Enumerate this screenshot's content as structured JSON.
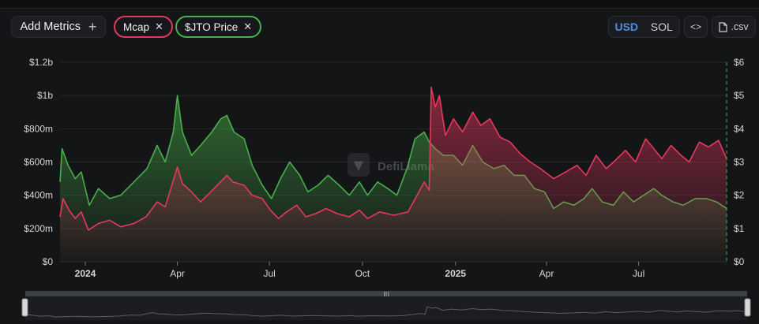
{
  "toolbar": {
    "add_metrics_label": "Add Metrics",
    "add_icon": "plus-icon",
    "chips": [
      {
        "label": "Mcap",
        "color": "#e8375f"
      },
      {
        "label": "$JTO Price",
        "color": "#48b04a"
      }
    ],
    "remove_icon": "close-icon",
    "currency": {
      "options": [
        "USD",
        "SOL"
      ],
      "selected": "USD"
    },
    "embed_icon": "code-icon",
    "csv_label": ".csv",
    "csv_icon": "file-icon"
  },
  "watermark": "DefiLlama",
  "chart_data": {
    "type": "line",
    "x_start": "2023-12-07",
    "x_end": "2025-09-26",
    "x_ticks": [
      {
        "label": "2024",
        "date": "2024-01-01",
        "bold": true
      },
      {
        "label": "Apr",
        "date": "2024-04-01"
      },
      {
        "label": "Jul",
        "date": "2024-07-01"
      },
      {
        "label": "Oct",
        "date": "2024-10-01"
      },
      {
        "label": "2025",
        "date": "2025-01-01",
        "bold": true
      },
      {
        "label": "Apr",
        "date": "2025-04-01"
      },
      {
        "label": "Jul",
        "date": "2025-07-01"
      }
    ],
    "y_left": {
      "ticks": [
        "$0",
        "$200m",
        "$400m",
        "$600m",
        "$800m",
        "$1b",
        "$1.2b"
      ],
      "range": [
        0,
        1200
      ]
    },
    "y_right": {
      "ticks": [
        "$0",
        "$1",
        "$2",
        "$3",
        "$4",
        "$5",
        "$6"
      ],
      "range": [
        0,
        6
      ]
    },
    "grid": true,
    "series": [
      {
        "name": "Mcap",
        "axis": "left",
        "color": "#e8375f",
        "points": [
          [
            "2023-12-07",
            270
          ],
          [
            "2023-12-10",
            380
          ],
          [
            "2023-12-16",
            310
          ],
          [
            "2023-12-22",
            260
          ],
          [
            "2023-12-28",
            300
          ],
          [
            "2024-01-04",
            190
          ],
          [
            "2024-01-14",
            230
          ],
          [
            "2024-01-25",
            250
          ],
          [
            "2024-02-05",
            210
          ],
          [
            "2024-02-18",
            230
          ],
          [
            "2024-03-01",
            270
          ],
          [
            "2024-03-12",
            360
          ],
          [
            "2024-03-20",
            330
          ],
          [
            "2024-03-27",
            470
          ],
          [
            "2024-04-01",
            570
          ],
          [
            "2024-04-06",
            470
          ],
          [
            "2024-04-15",
            420
          ],
          [
            "2024-04-24",
            360
          ],
          [
            "2024-05-04",
            420
          ],
          [
            "2024-05-12",
            470
          ],
          [
            "2024-05-20",
            520
          ],
          [
            "2024-05-26",
            480
          ],
          [
            "2024-06-06",
            460
          ],
          [
            "2024-06-14",
            400
          ],
          [
            "2024-06-24",
            380
          ],
          [
            "2024-07-02",
            310
          ],
          [
            "2024-07-10",
            260
          ],
          [
            "2024-07-18",
            300
          ],
          [
            "2024-07-28",
            340
          ],
          [
            "2024-08-06",
            270
          ],
          [
            "2024-08-16",
            290
          ],
          [
            "2024-08-26",
            320
          ],
          [
            "2024-09-06",
            290
          ],
          [
            "2024-09-18",
            270
          ],
          [
            "2024-09-28",
            310
          ],
          [
            "2024-10-06",
            260
          ],
          [
            "2024-10-18",
            300
          ],
          [
            "2024-11-01",
            280
          ],
          [
            "2024-11-15",
            300
          ],
          [
            "2024-11-24",
            400
          ],
          [
            "2024-12-01",
            480
          ],
          [
            "2024-12-06",
            430
          ],
          [
            "2024-12-08",
            1050
          ],
          [
            "2024-12-12",
            930
          ],
          [
            "2024-12-16",
            1000
          ],
          [
            "2024-12-22",
            760
          ],
          [
            "2024-12-30",
            860
          ],
          [
            "2025-01-08",
            780
          ],
          [
            "2025-01-18",
            900
          ],
          [
            "2025-01-26",
            820
          ],
          [
            "2025-02-04",
            860
          ],
          [
            "2025-02-14",
            750
          ],
          [
            "2025-02-24",
            720
          ],
          [
            "2025-03-06",
            650
          ],
          [
            "2025-03-16",
            600
          ],
          [
            "2025-03-26",
            560
          ],
          [
            "2025-04-08",
            500
          ],
          [
            "2025-04-20",
            540
          ],
          [
            "2025-05-01",
            580
          ],
          [
            "2025-05-10",
            520
          ],
          [
            "2025-05-20",
            640
          ],
          [
            "2025-05-30",
            560
          ],
          [
            "2025-06-08",
            610
          ],
          [
            "2025-06-18",
            670
          ],
          [
            "2025-06-28",
            600
          ],
          [
            "2025-07-08",
            740
          ],
          [
            "2025-07-16",
            680
          ],
          [
            "2025-07-24",
            620
          ],
          [
            "2025-08-02",
            700
          ],
          [
            "2025-08-12",
            640
          ],
          [
            "2025-08-20",
            600
          ],
          [
            "2025-08-30",
            720
          ],
          [
            "2025-09-08",
            690
          ],
          [
            "2025-09-18",
            730
          ],
          [
            "2025-09-26",
            620
          ]
        ]
      },
      {
        "name": "$JTO Price",
        "axis": "right",
        "color": "#48b04a",
        "points": [
          [
            "2023-12-07",
            2.4
          ],
          [
            "2023-12-09",
            3.4
          ],
          [
            "2023-12-15",
            2.9
          ],
          [
            "2023-12-22",
            2.5
          ],
          [
            "2023-12-28",
            2.7
          ],
          [
            "2024-01-05",
            1.7
          ],
          [
            "2024-01-14",
            2.2
          ],
          [
            "2024-01-25",
            1.9
          ],
          [
            "2024-02-05",
            2.0
          ],
          [
            "2024-02-18",
            2.4
          ],
          [
            "2024-03-02",
            2.8
          ],
          [
            "2024-03-12",
            3.5
          ],
          [
            "2024-03-20",
            3.0
          ],
          [
            "2024-03-28",
            3.9
          ],
          [
            "2024-04-01",
            5.0
          ],
          [
            "2024-04-06",
            3.9
          ],
          [
            "2024-04-15",
            3.2
          ],
          [
            "2024-04-24",
            3.5
          ],
          [
            "2024-05-05",
            3.9
          ],
          [
            "2024-05-14",
            4.3
          ],
          [
            "2024-05-20",
            4.4
          ],
          [
            "2024-05-27",
            3.9
          ],
          [
            "2024-06-06",
            3.7
          ],
          [
            "2024-06-14",
            2.9
          ],
          [
            "2024-06-24",
            2.3
          ],
          [
            "2024-07-03",
            1.9
          ],
          [
            "2024-07-12",
            2.5
          ],
          [
            "2024-07-21",
            3.0
          ],
          [
            "2024-07-31",
            2.6
          ],
          [
            "2024-08-08",
            2.1
          ],
          [
            "2024-08-18",
            2.3
          ],
          [
            "2024-08-28",
            2.6
          ],
          [
            "2024-09-08",
            2.3
          ],
          [
            "2024-09-18",
            2.0
          ],
          [
            "2024-09-28",
            2.4
          ],
          [
            "2024-10-06",
            2.0
          ],
          [
            "2024-10-16",
            2.4
          ],
          [
            "2024-10-26",
            2.2
          ],
          [
            "2024-11-04",
            2.0
          ],
          [
            "2024-11-14",
            2.8
          ],
          [
            "2024-11-22",
            3.7
          ],
          [
            "2024-12-01",
            3.9
          ],
          [
            "2024-12-06",
            3.6
          ],
          [
            "2024-12-12",
            3.4
          ],
          [
            "2024-12-20",
            3.2
          ],
          [
            "2024-12-30",
            3.2
          ],
          [
            "2025-01-08",
            2.9
          ],
          [
            "2025-01-18",
            3.5
          ],
          [
            "2025-01-28",
            3.0
          ],
          [
            "2025-02-08",
            2.8
          ],
          [
            "2025-02-18",
            2.9
          ],
          [
            "2025-02-28",
            2.6
          ],
          [
            "2025-03-10",
            2.6
          ],
          [
            "2025-03-20",
            2.2
          ],
          [
            "2025-03-30",
            2.1
          ],
          [
            "2025-04-08",
            1.6
          ],
          [
            "2025-04-18",
            1.8
          ],
          [
            "2025-04-28",
            1.7
          ],
          [
            "2025-05-08",
            1.9
          ],
          [
            "2025-05-16",
            2.2
          ],
          [
            "2025-05-26",
            1.8
          ],
          [
            "2025-06-06",
            1.7
          ],
          [
            "2025-06-16",
            2.1
          ],
          [
            "2025-06-26",
            1.8
          ],
          [
            "2025-07-06",
            2.0
          ],
          [
            "2025-07-16",
            2.2
          ],
          [
            "2025-07-24",
            2.0
          ],
          [
            "2025-08-04",
            1.8
          ],
          [
            "2025-08-14",
            1.7
          ],
          [
            "2025-08-26",
            1.9
          ],
          [
            "2025-09-06",
            1.9
          ],
          [
            "2025-09-16",
            1.8
          ],
          [
            "2025-09-26",
            1.6
          ]
        ]
      }
    ]
  }
}
